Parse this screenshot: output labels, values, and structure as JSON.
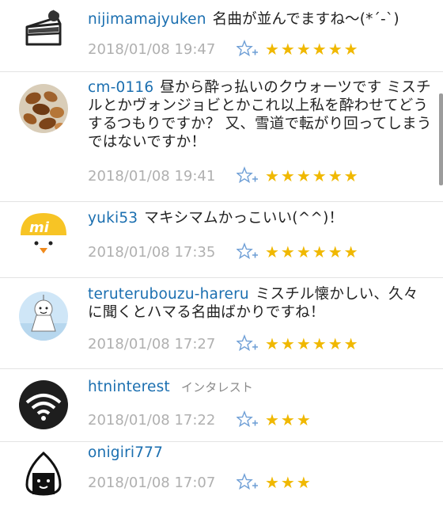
{
  "comments": [
    {
      "user": "nijimamajyuken",
      "text": "名曲が並んでますね〜(*´-`)",
      "time": "2018/01/08 19:47",
      "stars": "★★★★★★",
      "avatar_icon": "cake-slice-icon"
    },
    {
      "user": "cm-0116",
      "text": "昼から酔っ払いのクウォーツです ミスチルとかヴォンジョビとかこれ以上私を酔わせてどうするつもりですか？ 又、雪道で転がり回ってしまうではないですか！",
      "time": "2018/01/08 19:41",
      "stars": "★★★★★★",
      "avatar_icon": "nuts-icon"
    },
    {
      "user": "yuki53",
      "text": "マキシマムかっこいい(^^)！",
      "time": "2018/01/08 17:35",
      "stars": "★★★★★★",
      "avatar_icon": "yellow-chick-mi-icon"
    },
    {
      "user": "teruterubouzu-hareru",
      "text": "ミスチル懐かしい、久々に聞くとハマる名曲ばかりですね！",
      "time": "2018/01/08 17:27",
      "stars": "★★★★★★",
      "avatar_icon": "teru-teru-bozu-icon"
    },
    {
      "user": "htninterest",
      "subtitle": "インタレスト",
      "text": "",
      "time": "2018/01/08 17:22",
      "stars": "★★★",
      "avatar_icon": "wifi-signal-icon"
    },
    {
      "user": "onigiri777",
      "text": "",
      "time": "2018/01/08 17:07",
      "stars": "★★★",
      "avatar_icon": "onigiri-icon"
    }
  ],
  "colors": {
    "username": "#1b6fb0",
    "star": "#f0b800",
    "add_star_button": "#6f9fd6",
    "timestamp": "#b0b0b0"
  }
}
